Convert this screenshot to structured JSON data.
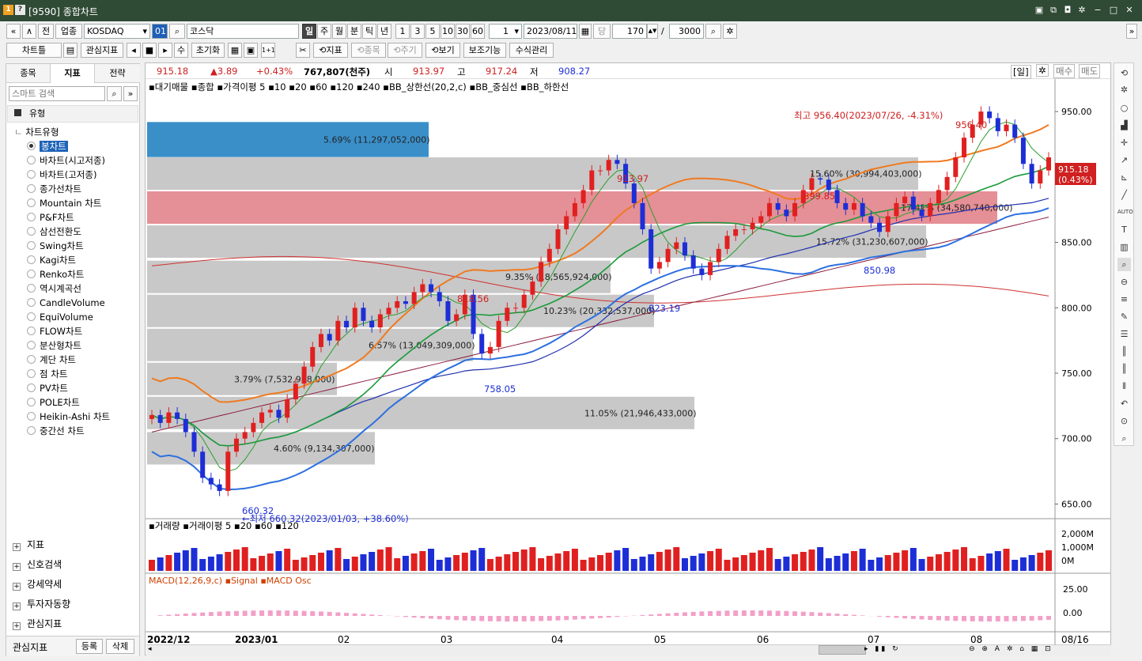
{
  "window": {
    "title": "[9590] 종합차트",
    "icon1": "1",
    "icon2": "?"
  },
  "toolbar1": {
    "nav_first": "«",
    "nav_up": "∧",
    "prev": "전",
    "sector": "업종",
    "market": "KOSDAQ",
    "code": "01",
    "name": "코스닥",
    "periods": [
      "일",
      "주",
      "월",
      "분",
      "틱",
      "년"
    ],
    "minutes": [
      "1",
      "3",
      "5",
      "10",
      "30",
      "60"
    ],
    "count": "1",
    "date": "2023/08/11",
    "dang": "당",
    "bars": "170",
    "slash": "/",
    "total": "3000",
    "nav_next": "»"
  },
  "toolbar2": {
    "chartbox": "차트틀",
    "watch": "관심지표",
    "step": "수",
    "reset": "초기화",
    "mult": "1+1",
    "indicator": "⟲지표",
    "item": "⟲종목",
    "period": "⟲주기",
    "view": "⟲보기",
    "aux": "보조기능",
    "formula": "수식관리"
  },
  "left": {
    "tabs": [
      "종목",
      "지표",
      "전략"
    ],
    "search_placeholder": "스마트 검색",
    "section_type": "유형",
    "group": "차트유형",
    "items": [
      "봉차트",
      "바차트(시고저종)",
      "바차트(고저종)",
      "종가선차트",
      "Mountain 차트",
      "P&F차트",
      "삼선전환도",
      "Swing차트",
      "Kagi차트",
      "Renko차트",
      "역시계곡선",
      "CandleVolume",
      "EquiVolume",
      "FLOW차트",
      "분산형차트",
      "계단 차트",
      "점 차트",
      "PV차트",
      "POLE차트",
      "Heikin-Ashi 차트",
      "중간선 차트"
    ],
    "sections": [
      "지표",
      "신호검색",
      "강세약세",
      "투자자동향",
      "관심지표"
    ],
    "bottom": {
      "label": "관심지표",
      "register": "등록",
      "delete": "삭제"
    }
  },
  "info": {
    "price": "915.18",
    "change": "▲3.89",
    "rate": "+0.43%",
    "volume": "767,807(천주)",
    "open_label": "시",
    "open": "913.97",
    "high_label": "고",
    "high": "917.24",
    "low_label": "저",
    "low": "908.27",
    "period_btn": "[일]",
    "buy": "매수",
    "sell": "매도"
  },
  "legend": {
    "bar_label": "대기매물",
    "main": "종합",
    "ma_label": "가격이평",
    "ma5": "5",
    "ma10": "10",
    "ma20": "20",
    "ma60": "60",
    "ma120": "120",
    "ma240": "240",
    "bb_up": "BB_상한선(20,2,c)",
    "bb_mid": "BB_중심선",
    "bb_low": "BB_하한선"
  },
  "annotations": {
    "high": "최고 956.40(2023/07/26, -4.31%)",
    "low": "←최저 660.32(2023/01/03, +38.60%)",
    "p913": "913.97",
    "p818": "818.56",
    "p823": "823.19",
    "p758": "758.05",
    "p899": "899.85",
    "p850": "850.98",
    "p956": "956.40",
    "p660": "660.32",
    "current": "915.18",
    "current_pct": "(0.43%)"
  },
  "overhang": [
    {
      "label": "5.69% (11,297,052,000)",
      "color": "#3a8fc9"
    },
    {
      "label": "15.60% (30,994,403,000)",
      "color": "#c8c8c8"
    },
    {
      "label": "17.41% (34,580,740,000)",
      "color": "#e58f96"
    },
    {
      "label": "15.72% (31,230,607,000)",
      "color": "#c8c8c8"
    },
    {
      "label": "9.35% (18,565,924,000)",
      "color": "#c8c8c8"
    },
    {
      "label": "10.23% (20,332,537,000)",
      "color": "#c8c8c8"
    },
    {
      "label": "6.57% (13,049,309,000)",
      "color": "#c8c8c8"
    },
    {
      "label": "3.79% (7,532,988,000)",
      "color": "#c8c8c8"
    },
    {
      "label": "11.05% (21,946,433,000)",
      "color": "#c8c8c8"
    },
    {
      "label": "4.60% (9,134,307,000)",
      "color": "#c8c8c8"
    }
  ],
  "vol_legend": {
    "label": "거래량",
    "ma": "거래이평",
    "a": "5",
    "b": "20",
    "c": "60",
    "d": "120"
  },
  "macd_legend": {
    "macd": "MACD(12,26,9,c)",
    "signal": "Signal",
    "osc": "MACD Osc"
  },
  "x_axis": [
    "2022/12",
    "2023/01",
    "02",
    "03",
    "04",
    "05",
    "06",
    "07",
    "08",
    "08/16"
  ],
  "chart_data": {
    "type": "candlestick",
    "ylim": [
      640,
      970
    ],
    "yticks": [
      "950.00",
      "900.00",
      "850.00",
      "800.00",
      "750.00",
      "700.00",
      "650.00"
    ],
    "vol_ticks": [
      "2,000M",
      "1,000M",
      "0M"
    ],
    "macd_ticks": [
      "25.00",
      "0.00"
    ],
    "close": [
      718,
      712,
      720,
      715,
      705,
      690,
      670,
      665,
      660,
      690,
      700,
      705,
      712,
      720,
      722,
      716,
      730,
      742,
      755,
      770,
      780,
      775,
      790,
      785,
      800,
      790,
      785,
      795,
      800,
      805,
      803,
      812,
      818,
      812,
      805,
      790,
      795,
      810,
      780,
      765,
      770,
      790,
      800,
      800,
      810,
      820,
      835,
      845,
      860,
      870,
      880,
      890,
      905,
      905,
      913,
      910,
      895,
      880,
      860,
      830,
      835,
      845,
      850,
      840,
      830,
      825,
      835,
      845,
      855,
      860,
      860,
      865,
      870,
      880,
      875,
      870,
      880,
      890,
      899,
      898,
      890,
      880,
      875,
      880,
      870,
      865,
      858,
      870,
      880,
      885,
      875,
      870,
      880,
      890,
      900,
      915,
      930,
      940,
      950,
      945,
      935,
      940,
      930,
      910,
      895,
      905,
      915
    ]
  },
  "colors": {
    "up": "#e02020",
    "down": "#1d2ed6",
    "ma5": "#2e9e2e",
    "bb_up": "#f07a20",
    "bb_mid": "#1a9a3a",
    "bb_low": "#2c6fe0",
    "ma60": "#2030b0",
    "ma120": "#8a1a3a",
    "ma240": "#d03030"
  }
}
